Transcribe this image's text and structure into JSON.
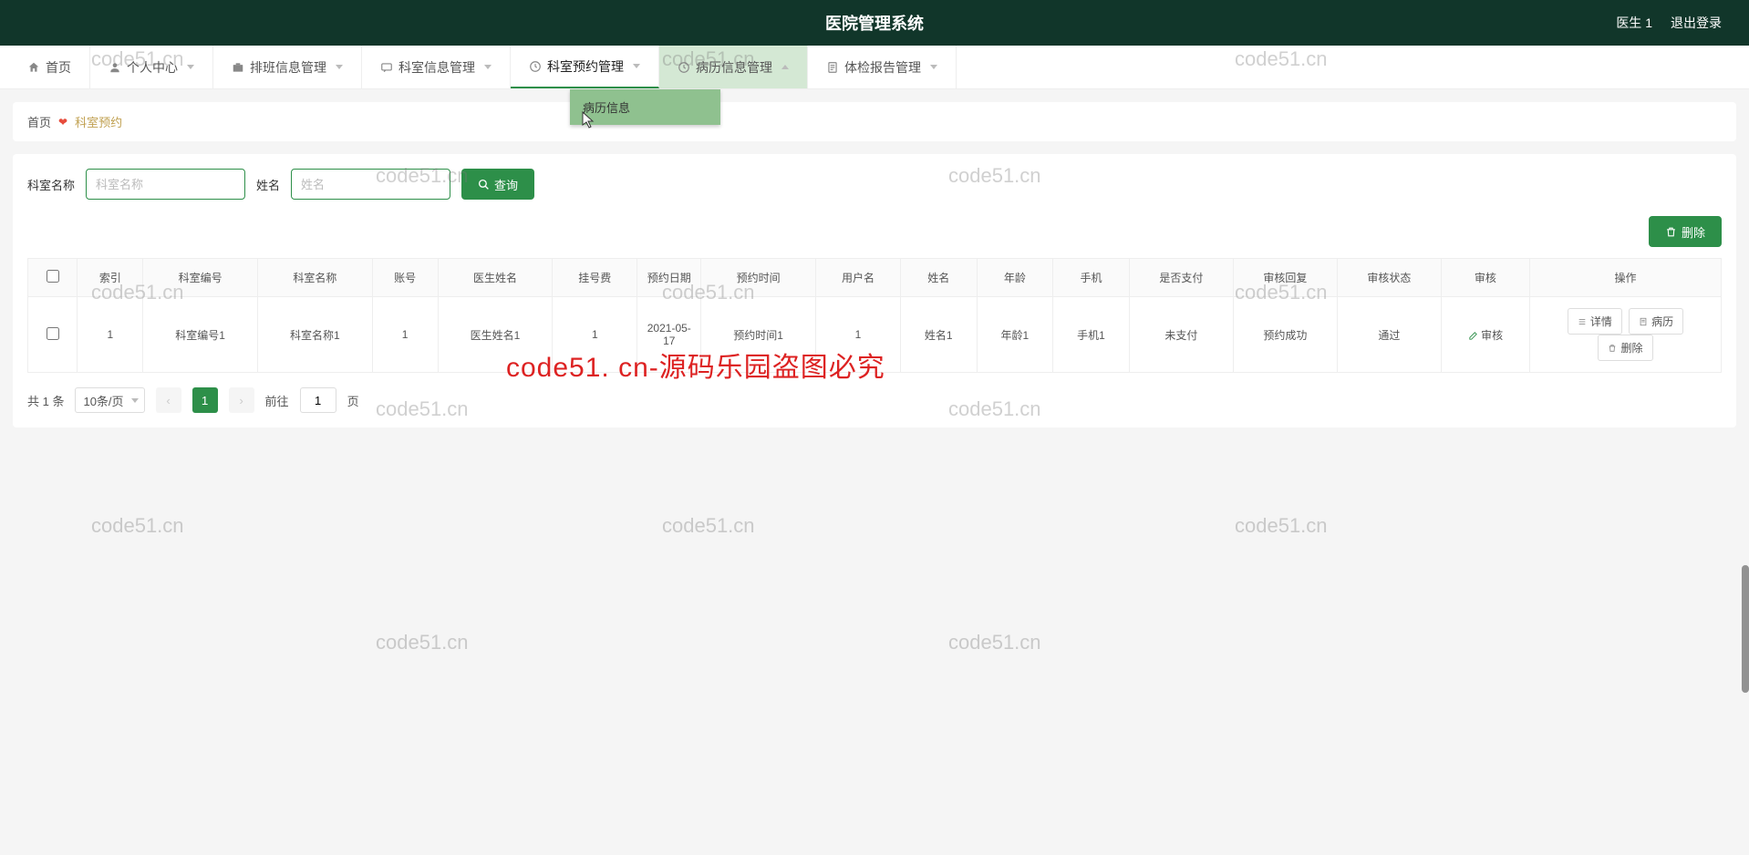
{
  "header": {
    "title": "医院管理系统",
    "user": "医生 1",
    "logout": "退出登录"
  },
  "nav": {
    "home": "首页",
    "personal": "个人中心",
    "schedule": "排班信息管理",
    "dept_info": "科室信息管理",
    "dept_appt": "科室预约管理",
    "record": "病历信息管理",
    "exam": "体检报告管理"
  },
  "dropdown": {
    "record_info": "病历信息"
  },
  "breadcrumb": {
    "home": "首页",
    "current": "科室预约"
  },
  "search": {
    "dept_label": "科室名称",
    "dept_placeholder": "科室名称",
    "name_label": "姓名",
    "name_placeholder": "姓名",
    "search_btn": "查询"
  },
  "actions": {
    "delete_batch": "删除"
  },
  "table": {
    "headers": {
      "index": "索引",
      "dept_no": "科室编号",
      "dept_name": "科室名称",
      "account": "账号",
      "doctor": "医生姓名",
      "fee": "挂号费",
      "date": "预约日期",
      "time": "预约时间",
      "username": "用户名",
      "name": "姓名",
      "age": "年龄",
      "phone": "手机",
      "paid": "是否支付",
      "review_reply": "审核回复",
      "review_status": "审核状态",
      "review": "审核",
      "ops": "操作"
    },
    "row": {
      "index": "1",
      "dept_no": "科室编号1",
      "dept_name": "科室名称1",
      "account": "1",
      "doctor": "医生姓名1",
      "fee": "1",
      "date": "2021-05-17",
      "time": "预约时间1",
      "username": "1",
      "name": "姓名1",
      "age": "年龄1",
      "phone": "手机1",
      "paid": "未支付",
      "review_reply": "预约成功",
      "review_status": "通过",
      "review_link": "审核",
      "detail": "详情",
      "record": "病历",
      "delete": "删除"
    }
  },
  "pagination": {
    "total": "共 1 条",
    "page_size": "10条/页",
    "current_page": "1",
    "goto_prefix": "前往",
    "goto_value": "1",
    "goto_suffix": "页"
  },
  "watermarks": {
    "small": "code51.cn",
    "main": "code51. cn-源码乐园盗图必究"
  }
}
